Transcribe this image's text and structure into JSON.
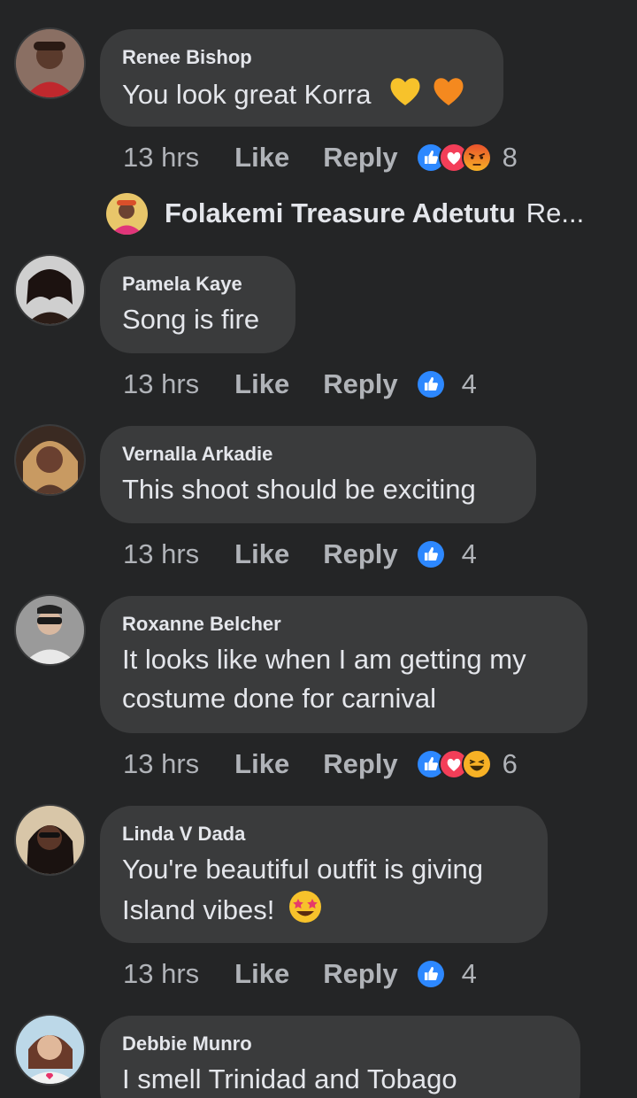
{
  "comments": [
    {
      "author": "Renee Bishop",
      "text": "You look great Korra",
      "emojis": [
        "yellow-heart",
        "orange-heart"
      ],
      "time": "13 hrs",
      "like_label": "Like",
      "reply_label": "Reply",
      "reactions": [
        "like",
        "love",
        "angry"
      ],
      "reaction_count": "8",
      "reply_preview": {
        "author": "Folakemi Treasure Adetutu",
        "snippet": "Re..."
      }
    },
    {
      "author": "Pamela Kaye",
      "text": "Song is fire",
      "time": "13 hrs",
      "like_label": "Like",
      "reply_label": "Reply",
      "reactions": [
        "like"
      ],
      "reaction_count": "4"
    },
    {
      "author": "Vernalla Arkadie",
      "text": "This shoot should be exciting",
      "time": "13 hrs",
      "like_label": "Like",
      "reply_label": "Reply",
      "reactions": [
        "like"
      ],
      "reaction_count": "4"
    },
    {
      "author": "Roxanne Belcher",
      "text_line1": "It looks like when I am getting my",
      "text_line2": "costume done for carnival",
      "time": "13 hrs",
      "like_label": "Like",
      "reply_label": "Reply",
      "reactions": [
        "like",
        "love",
        "haha"
      ],
      "reaction_count": "6"
    },
    {
      "author": "Linda V Dada",
      "text_line1": "You're beautiful outfit is giving",
      "text_line2": "Island vibes!",
      "emojis": [
        "star-struck"
      ],
      "time": "13 hrs",
      "like_label": "Like",
      "reply_label": "Reply",
      "reactions": [
        "like"
      ],
      "reaction_count": "4"
    },
    {
      "author": "Debbie Munro",
      "text": "I smell Trinidad and Tobago"
    }
  ],
  "colors": {
    "background": "#242526",
    "bubble": "#3a3b3c",
    "primary_text": "#e4e6eb",
    "secondary_text": "#b0b3b8",
    "like_blue": "#2d88ff",
    "love_red": "#f33e58",
    "reaction_yellow": "#f7b125"
  }
}
